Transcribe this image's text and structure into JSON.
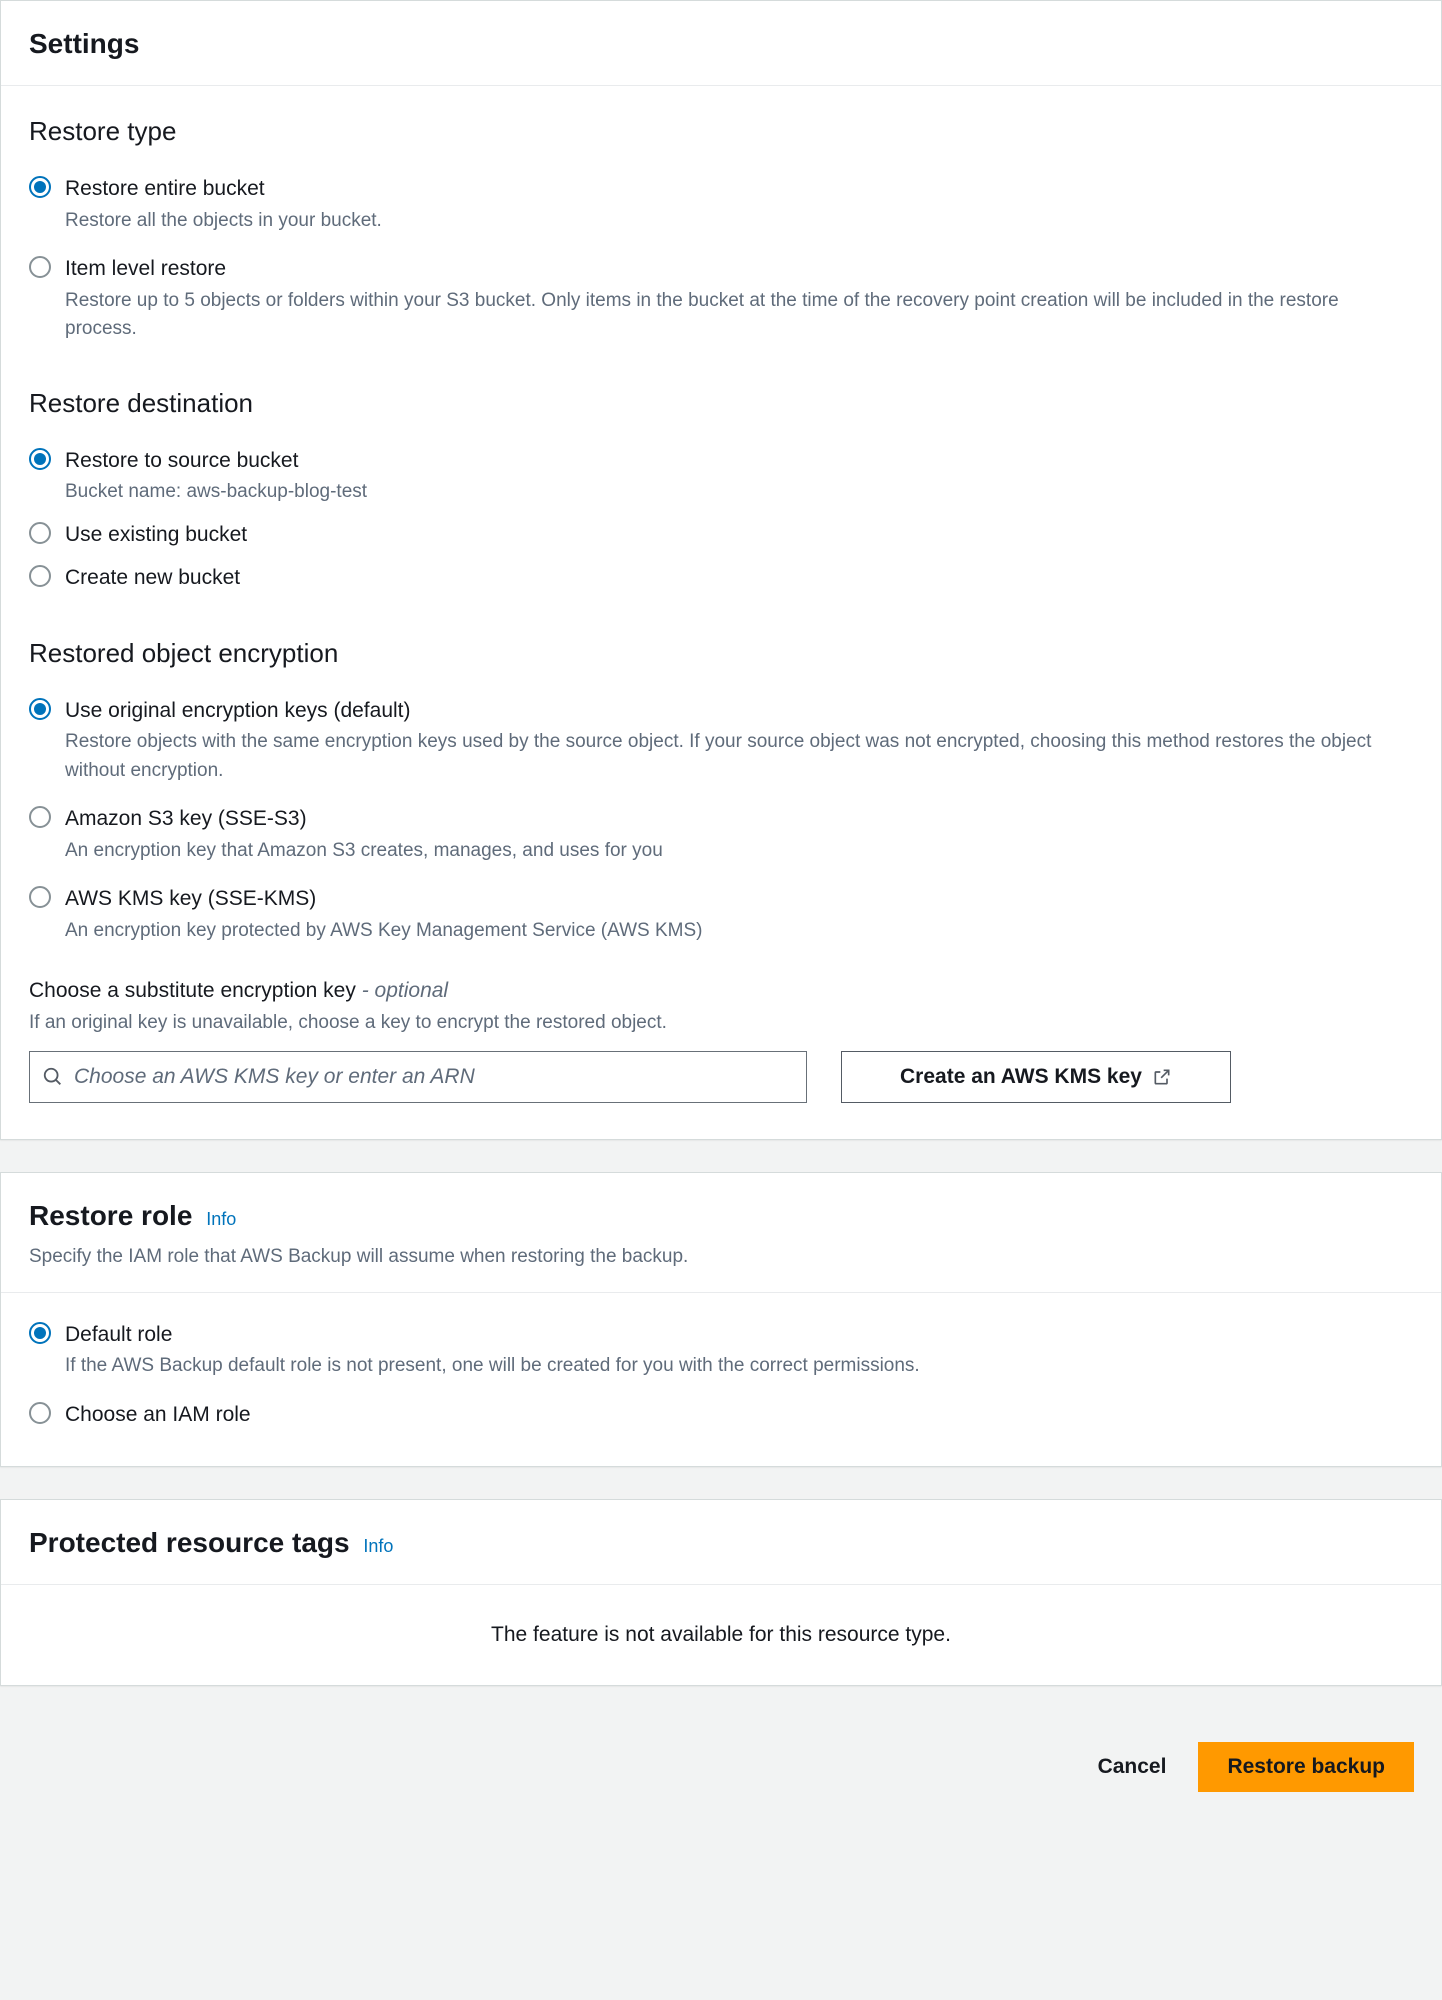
{
  "settings": {
    "title": "Settings",
    "restore_type": {
      "title": "Restore type",
      "options": [
        {
          "label": "Restore entire bucket",
          "desc": "Restore all the objects in your bucket.",
          "selected": true
        },
        {
          "label": "Item level restore",
          "desc": "Restore up to 5 objects or folders within your S3 bucket. Only items in the bucket at the time of the recovery point creation will be included in the restore process.",
          "selected": false
        }
      ]
    },
    "restore_destination": {
      "title": "Restore destination",
      "options": [
        {
          "label": "Restore to source bucket",
          "desc": "Bucket name: aws-backup-blog-test",
          "selected": true
        },
        {
          "label": "Use existing bucket",
          "desc": null,
          "selected": false
        },
        {
          "label": "Create new bucket",
          "desc": null,
          "selected": false
        }
      ]
    },
    "encryption": {
      "title": "Restored object encryption",
      "options": [
        {
          "label": "Use original encryption keys (default)",
          "desc": "Restore objects with the same encryption keys used by the source object. If your source object was not encrypted, choosing this method restores the object without encryption.",
          "selected": true
        },
        {
          "label": "Amazon S3 key (SSE-S3)",
          "desc": "An encryption key that Amazon S3 creates, manages, and uses for you",
          "selected": false
        },
        {
          "label": "AWS KMS key (SSE-KMS)",
          "desc": "An encryption key protected by AWS Key Management Service (AWS KMS)",
          "selected": false
        }
      ],
      "substitute": {
        "label_main": "Choose a substitute encryption key ",
        "label_opt": "- optional",
        "hint": "If an original key is unavailable, choose a key to encrypt the restored object.",
        "placeholder": "Choose an AWS KMS key or enter an ARN",
        "create_btn": "Create an AWS KMS key"
      }
    }
  },
  "restore_role": {
    "title": "Restore role",
    "info": "Info",
    "sub": "Specify the IAM role that AWS Backup will assume when restoring the backup.",
    "options": [
      {
        "label": "Default role",
        "desc": "If the AWS Backup default role is not present, one will be created for you with the correct permissions.",
        "selected": true
      },
      {
        "label": "Choose an IAM role",
        "desc": null,
        "selected": false
      }
    ]
  },
  "tags": {
    "title": "Protected resource tags",
    "info": "Info",
    "not_available": "The feature is not available for this resource type."
  },
  "footer": {
    "cancel": "Cancel",
    "restore": "Restore backup"
  }
}
